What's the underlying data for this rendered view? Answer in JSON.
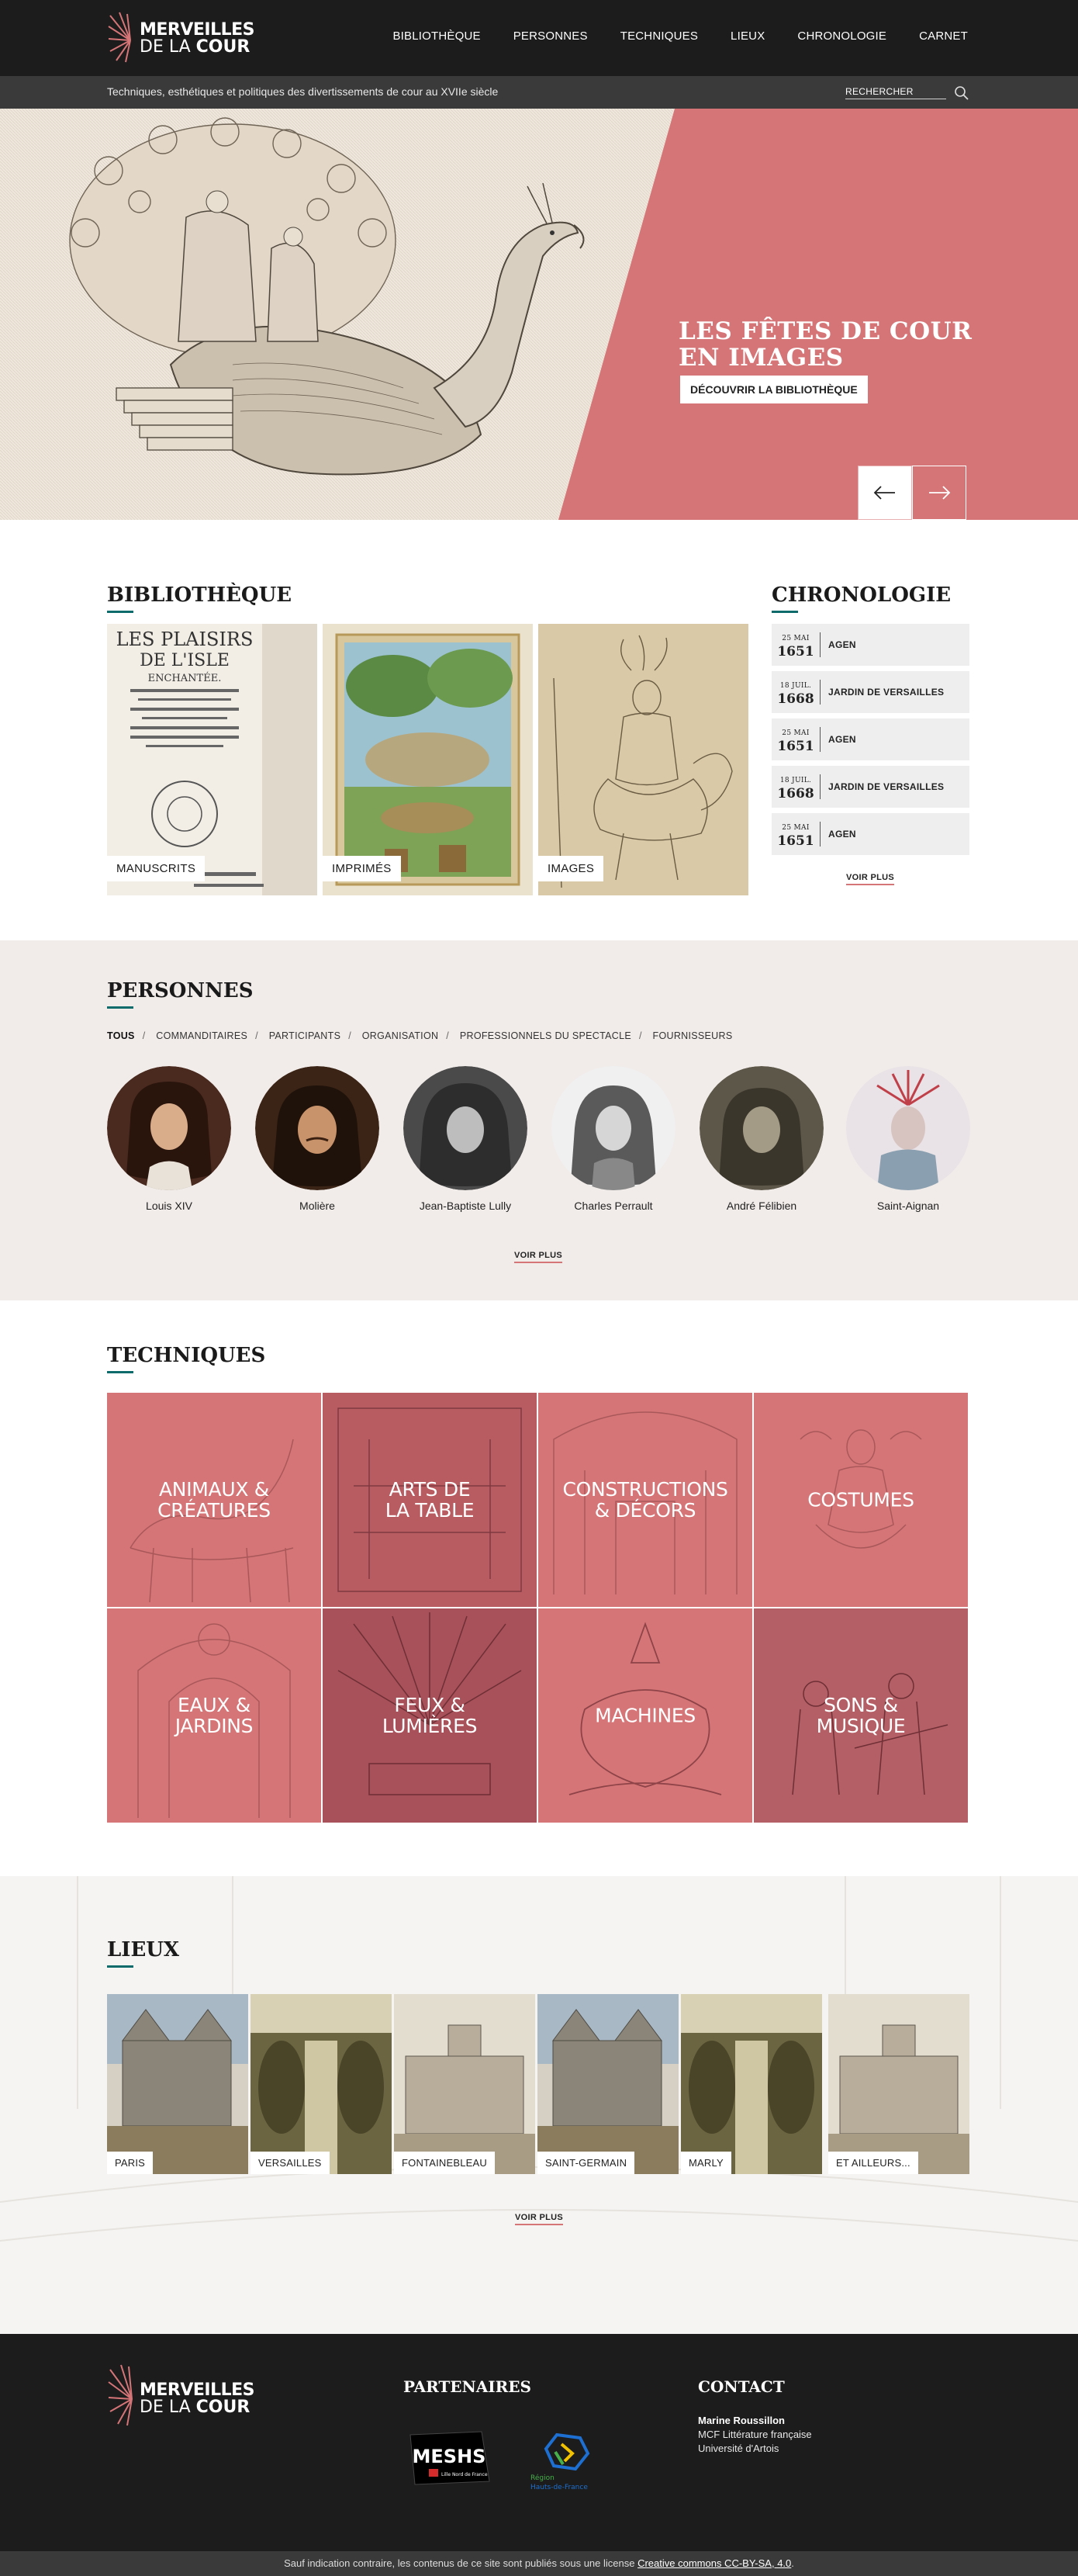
{
  "brand": {
    "line1": "MERVEILLES",
    "line2a": "DE LA",
    "line2b": "COUR",
    "accent": "#d57577",
    "teal": "#0d6b6b"
  },
  "nav": {
    "items": [
      "BIBLIOTHÈQUE",
      "PERSONNES",
      "TECHNIQUES",
      "LIEUX",
      "CHRONOLOGIE",
      "CARNET"
    ]
  },
  "subbar": {
    "tagline": "Techniques, esthétiques et politiques des divertissements de cour au XVIIe siècle",
    "search_placeholder": "RECHERCHER"
  },
  "hero": {
    "title_line1": "LES FÊTES DE COUR",
    "title_line2": "EN IMAGES",
    "cta": "DÉCOUVRIR LA BIBLIOTHÈQUE",
    "bg": "#d57577"
  },
  "bibliotheque": {
    "title": "BIBLIOTHÈQUE",
    "cards": [
      "MANUSCRITS",
      "IMPRIMÉS",
      "IMAGES"
    ],
    "book_title": [
      "LES PLAISIRS",
      "DE L'ISLE",
      "ENCHANTÉE."
    ]
  },
  "chronologie": {
    "title": "CHRONOLOGIE",
    "items": [
      {
        "dm": "25 MAI",
        "year": "1651",
        "place": "AGEN"
      },
      {
        "dm": "18 JUIL.",
        "year": "1668",
        "place": "JARDIN DE VERSAILLES"
      },
      {
        "dm": "25 MAI",
        "year": "1651",
        "place": "AGEN"
      },
      {
        "dm": "18 JUIL.",
        "year": "1668",
        "place": "JARDIN DE VERSAILLES"
      },
      {
        "dm": "25 MAI",
        "year": "1651",
        "place": "AGEN"
      }
    ],
    "more": "VOIR PLUS"
  },
  "personnes": {
    "title": "PERSONNES",
    "filters": [
      "TOUS",
      "COMMANDITAIRES",
      "PARTICIPANTS",
      "ORGANISATION",
      "PROFESSIONNELS DU SPECTACLE",
      "FOURNISSEURS"
    ],
    "people": [
      "Louis XIV",
      "Molière",
      "Jean-Baptiste Lully",
      "Charles Perrault",
      "André Félibien",
      "Saint-Aignan"
    ],
    "more": "VOIR PLUS"
  },
  "techniques": {
    "title": "TECHNIQUES",
    "tiles": [
      "ANIMAUX &\nCRÉATURES",
      "ARTS DE\nLA TABLE",
      "CONSTRUCTIONS\n& DÉCORS",
      "COSTUMES",
      "EAUX &\nJARDINS",
      "FEUX &\nLUMIÈRES",
      "MACHINES",
      "SONS &\nMUSIQUE"
    ]
  },
  "lieux": {
    "title": "LIEUX",
    "places": [
      "PARIS",
      "VERSAILLES",
      "FONTAINEBLEAU",
      "SAINT-GERMAIN",
      "MARLY",
      "ET AILLEURS..."
    ],
    "more": "VOIR PLUS"
  },
  "footer": {
    "partners_title": "PARTENAIRES",
    "contact_title": "CONTACT",
    "contact_name": "Marine Roussillon",
    "contact_role": "MCF Littérature française",
    "contact_org": "Université d'Artois",
    "meshs": "MESHS",
    "meshs_sub": "Lille Nord de France",
    "region1": "Région",
    "region2": "Hauts-de-France",
    "legal_prefix": "Sauf indication contraire, les contenus de ce site sont publiés sous une license ",
    "legal_link": "Creative commons CC-BY-SA, 4.0",
    "legal_suffix": "."
  }
}
